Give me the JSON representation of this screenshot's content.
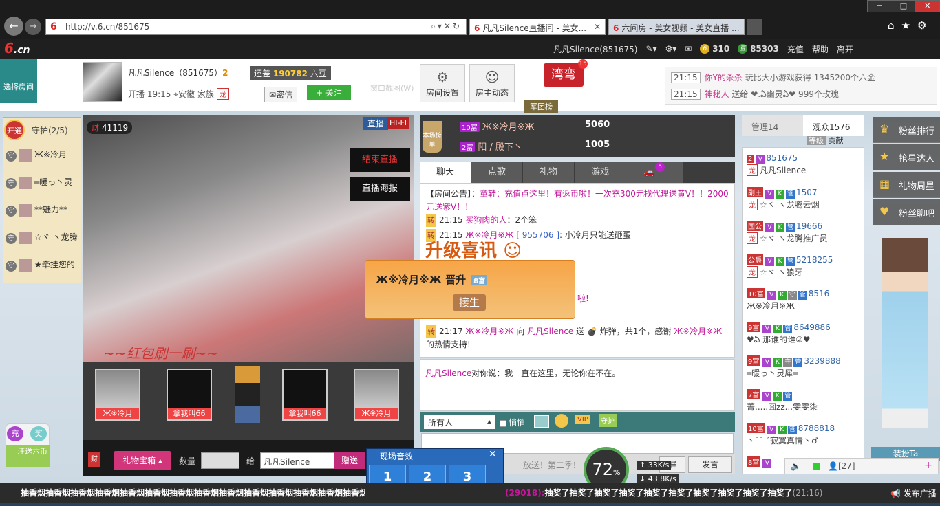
{
  "browser": {
    "url": "http://v.6.cn/851675",
    "tabs": [
      {
        "label": "凡凡Silence直播间 - 美女..."
      },
      {
        "label": "六间房 - 美女视频 - 美女直播 ..."
      }
    ],
    "win_controls": {
      "min": "─",
      "max": "□",
      "close": "✕"
    }
  },
  "site": {
    "logo": "6",
    "logo_suffix": ".cn",
    "user": "凡凡Silence(851675)",
    "gold": "310",
    "beans": "85303",
    "recharge": "充值",
    "help": "帮助",
    "leave": "离开"
  },
  "room": {
    "select_room": "选择房间",
    "host_name": "凡凡Silence（851675）",
    "host_level": "2",
    "gap_prefix": "还差",
    "gap_value": "190782",
    "gap_suffix": "六豆",
    "start_time": "开播 19:15",
    "location": "安徽",
    "family_label": "家族",
    "family_badge": "龙",
    "msg_btn": "密信",
    "follow_btn": "+ 关注",
    "snapshot": "窗口截图(W)",
    "settings_btn": "房间设置",
    "activity_btn": "房主动态",
    "badge_text": "湾弯",
    "badge_count": "15",
    "army": "军团榜"
  },
  "news": [
    {
      "time": "21:15",
      "user": "你Y的杀杀",
      "text": "玩比大小游戏获得 1345200个六金"
    },
    {
      "time": "21:15",
      "user": "神秘人",
      "text": "送给 ❤.ఏ幽灵ఏ❤ 999个玫瑰"
    }
  ],
  "guards": {
    "open": "开通",
    "title": "守护(2/5)",
    "items": [
      "Ж※冷月",
      "═暖っ丶灵",
      "**魅力**",
      "☆ヾ ヽ龙腾",
      "★牵挂您的"
    ]
  },
  "video": {
    "viewers": "41119",
    "live": "直播",
    "hifi": "HI-FI",
    "end_live": "结束直播",
    "poster": "直播海报",
    "caption": "~~红包刷一刷~~",
    "seats": [
      "Ж※冷月",
      "拿我叫66",
      "拿我叫66",
      "Ж※冷月"
    ]
  },
  "giftbar": {
    "gift_box": "礼物宝箱",
    "qty_label": "数量",
    "to_label": "给",
    "to_value": "凡凡Silence",
    "send": "赠送"
  },
  "rank": {
    "icon": "本场榜单",
    "items": [
      {
        "level": "10富",
        "name": "Ж※冷月※Ж",
        "amount": "5060"
      },
      {
        "level": "2富",
        "name": "阳 / 殿下丶",
        "amount": "1005"
      }
    ]
  },
  "chat_tabs": {
    "chat": "聊天",
    "song": "点歌",
    "gift": "礼物",
    "game": "游戏",
    "car_count": "5"
  },
  "chat": {
    "notice_label": "【房间公告】：",
    "notice": "童鞋：充值点这里！有返币啦！一次充300元找代理送黄V！！2000元送紫V！！",
    "l2_time": "21:15",
    "l2_user": "买狗肉的人",
    "l2_text": "：2个笨",
    "l3_time": "21:15",
    "l3_user": "Ж※冷月※Ж",
    "l3_id": "[ 955706 ]",
    "l3_text": ": 小冷月只能送砸蛋",
    "l4_tail": "啦!",
    "l5_time": "21:17",
    "l5_user": "Ж※冷月※Ж",
    "l5_to": "向",
    "l5_host": "凡凡Silence",
    "l5_send": "送",
    "l5_text": "炸弹，共1个，感谢",
    "l5_user2": "Ж※冷月※Ж",
    "l5_end": "的热情支持!",
    "tag": "转"
  },
  "upgrade": {
    "title": "升级喜讯",
    "user": "Ж※冷月※Ж",
    "text": "晋升",
    "level": "8富",
    "btn": "接生"
  },
  "private_chat": {
    "user": "凡凡Silence",
    "text": "对你说：我一直在这里，无论你在不在。"
  },
  "input": {
    "target": "所有人",
    "whisper": "悄悄",
    "vip": "VIP",
    "guard": "守护",
    "send": "发言",
    "screen": "屏",
    "hint": "放送！第二季！"
  },
  "speed": {
    "percent": "72",
    "up": "33K/s",
    "down": "43.8K/s"
  },
  "sfx": {
    "title": "现场音效",
    "buttons": [
      {
        "n": "1",
        "label": "笑声"
      },
      {
        "n": "2",
        "label": "欢呼"
      },
      {
        "n": "3",
        "label": "起哄"
      }
    ]
  },
  "userpanel": {
    "tab_admin": "管理14",
    "tab_audience": "观众1576",
    "level": "等级",
    "contrib": "贡献",
    "users": [
      {
        "id": "851675",
        "name": "凡凡Silence",
        "badge": "2"
      },
      {
        "id": "1507",
        "name": "☆ヾ ヽ龙腾云烟",
        "badge": "副王"
      },
      {
        "id": "19666",
        "name": "☆ヾ ヽ龙腾推广员",
        "badge": "国公"
      },
      {
        "id": "5218255",
        "name": "☆ヾ ヽ狼牙",
        "badge": "公爵"
      },
      {
        "id": "8516",
        "name": "Ж※冷月※Ж",
        "badge": "10富"
      },
      {
        "id": "8649886",
        "name": "♥ఏ 那谁的谁②♥",
        "badge": "9富"
      },
      {
        "id": "3239888",
        "name": "═暖っ丶灵犀═",
        "badge": "9富"
      },
      {
        "id": "",
        "name": "菁.....囧zz...雯雯柒",
        "badge": "7富"
      },
      {
        "id": "8788818",
        "name": "丶¯¯ ´寂寞真情丶♂",
        "badge": "10富"
      },
      {
        "id": "",
        "name": "",
        "badge": "8富"
      }
    ],
    "online_count": "[27]"
  },
  "sidebar": {
    "fans_rank": "粉丝排行",
    "star": "抢星达人",
    "gift_week": "礼物周星",
    "fans_chat": "粉丝聊吧",
    "dressup": "装扮Ta"
  },
  "leftbtns": {
    "recharge": "充",
    "lottery": "奖",
    "wang": "汪送六币"
  },
  "marquee": {
    "left": "抽香烟抽香烟抽香烟抽香烟抽香烟抽香烟抽香烟抽香烟抽香烟抽香烟抽香烟抽香烟抽香烟抽香烟抽香烟",
    "right_id": "(29018):",
    "right_text": "抽奖了抽奖了抽奖了抽奖了抽奖了抽奖了抽奖了抽奖了抽奖了抽奖了",
    "right_time": "(21:16)",
    "broadcast": "发布广播"
  }
}
